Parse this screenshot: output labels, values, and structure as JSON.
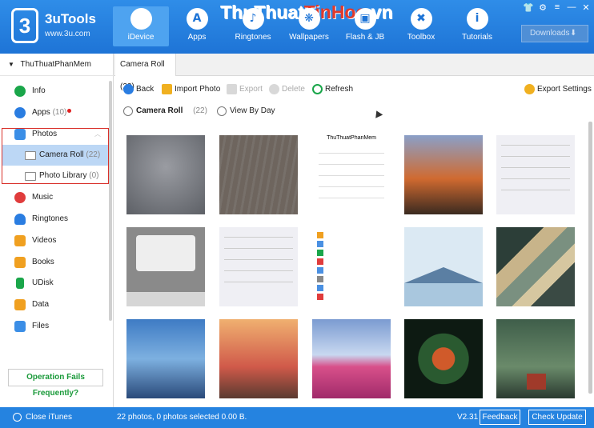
{
  "app": {
    "name": "3uTools",
    "site": "www.3u.com",
    "logo_glyph": "3"
  },
  "watermark": {
    "part1": "ThuThuat",
    "part2": "TinHoc",
    "part3": ".vn"
  },
  "nav": [
    {
      "label": "iDevice",
      "icon": "apple-icon",
      "glyph": "",
      "active": true
    },
    {
      "label": "Apps",
      "icon": "apps-icon",
      "glyph": "A"
    },
    {
      "label": "Ringtones",
      "icon": "bell-icon",
      "glyph": "♪"
    },
    {
      "label": "Wallpapers",
      "icon": "wallpaper-icon",
      "glyph": "❋"
    },
    {
      "label": "Flash & JB",
      "icon": "box-icon",
      "glyph": "▣"
    },
    {
      "label": "Toolbox",
      "icon": "toolbox-icon",
      "glyph": "✖"
    },
    {
      "label": "Tutorials",
      "icon": "info-icon",
      "glyph": "i"
    }
  ],
  "window_controls": {
    "shirt": "👕",
    "settings": "⚙",
    "menu": "≡",
    "minimize": "—",
    "close": "✕"
  },
  "downloads": {
    "label": "Downloads",
    "icon": "download-icon",
    "glyph": "⬇"
  },
  "device": {
    "name": "ThuThuatPhanMem",
    "arrow": "▼"
  },
  "sidebar": {
    "items": [
      {
        "label": "Info",
        "icon": "info-icon",
        "color": "#1aa64a"
      },
      {
        "label": "Apps",
        "count": "(10)",
        "icon": "apps-icon",
        "color": "#2a7de1",
        "badge": true
      },
      {
        "label": "Photos",
        "icon": "photos-icon",
        "color": "#3b8ee6"
      },
      {
        "label": "Camera Roll",
        "count": "(22)",
        "icon": "folder-icon",
        "sub": true,
        "selected": true
      },
      {
        "label": "Photo Library",
        "count": "(0)",
        "icon": "folder-icon",
        "sub": true
      },
      {
        "label": "Music",
        "icon": "music-icon",
        "color": "#e03c3c"
      },
      {
        "label": "Ringtones",
        "icon": "bell-icon",
        "color": "#2a7de1"
      },
      {
        "label": "Videos",
        "icon": "video-icon",
        "color": "#f0a020"
      },
      {
        "label": "Books",
        "icon": "books-icon",
        "color": "#f0a020"
      },
      {
        "label": "UDisk",
        "icon": "udisk-icon",
        "color": "#1aa64a"
      },
      {
        "label": "Data",
        "icon": "data-icon",
        "color": "#f0a020"
      },
      {
        "label": "Files",
        "icon": "files-icon",
        "color": "#3b8ee6"
      }
    ],
    "ops_button": "Operation Fails Frequently?"
  },
  "tab": {
    "label": "Camera Roll (22)"
  },
  "toolbar": {
    "back": "Back",
    "import": "Import Photo",
    "export": "Export",
    "delete": "Delete",
    "refresh": "Refresh",
    "export_settings": "Export Settings"
  },
  "view": {
    "camera_roll": "Camera Roll",
    "count": "(22)",
    "by_day": "View By Day"
  },
  "thumbs": [
    {
      "kind": "phone-ui",
      "bg": "#7a7d83"
    },
    {
      "kind": "wood",
      "bg": "#6e655e"
    },
    {
      "kind": "contact",
      "bg": "#ffffff",
      "text": "ThuThuatPhanMem"
    },
    {
      "kind": "homescreen",
      "bg": "#c66a2f"
    },
    {
      "kind": "settings",
      "bg": "#efeff4"
    },
    {
      "kind": "dialog",
      "bg": "#8a8a8a"
    },
    {
      "kind": "settings",
      "bg": "#efeff4"
    },
    {
      "kind": "settings-list",
      "bg": "#ffffff"
    },
    {
      "kind": "mountain",
      "bg": "#dbe9f3"
    },
    {
      "kind": "stripes",
      "bg": "#4a5a52"
    },
    {
      "kind": "car",
      "bg": "#3e7bc4"
    },
    {
      "kind": "rock",
      "bg": "#d27a4a"
    },
    {
      "kind": "field",
      "bg": "#7b9bd1"
    },
    {
      "kind": "flowers",
      "bg": "#0d1a12"
    },
    {
      "kind": "cabin",
      "bg": "#3f5e4a"
    }
  ],
  "status": {
    "close_itunes": "Close iTunes",
    "summary": "22 photos, 0 photos selected 0.00 B.",
    "version": "V2.31",
    "feedback": "Feedback",
    "check_update": "Check Update"
  }
}
